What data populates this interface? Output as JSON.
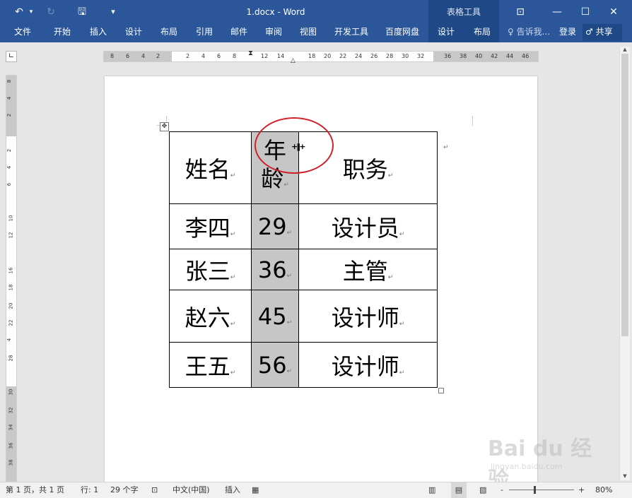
{
  "titlebar": {
    "title": "1.docx - Word",
    "context_group": "表格工具",
    "undo_icon": "↶",
    "redo_icon": "↻",
    "save_icon": "🖫",
    "customize_icon": "▾",
    "ribbon_display_icon": "⊡",
    "minimize_icon": "—",
    "maximize_icon": "☐",
    "close_icon": "✕"
  },
  "ribbon": {
    "tabs": [
      "文件",
      "开始",
      "插入",
      "设计",
      "布局",
      "引用",
      "邮件",
      "审阅",
      "视图",
      "开发工具",
      "百度网盘"
    ],
    "context_tabs": [
      "设计",
      "布局"
    ],
    "tell_me": "告诉我...",
    "signin": "登录",
    "share": "共享"
  },
  "ruler": {
    "h_left_ticks": [
      "8",
      "6",
      "4",
      "2"
    ],
    "h_ticks": [
      "2",
      "4",
      "6",
      "8",
      "12",
      "14",
      "18",
      "20",
      "22",
      "24",
      "26",
      "28",
      "30",
      "32",
      "36",
      "38",
      "40",
      "42",
      "44",
      "46"
    ],
    "v_ticks": [
      "8",
      "4",
      "2",
      "2",
      "4",
      "6",
      "10",
      "12",
      "16",
      "18",
      "20",
      "22",
      "4",
      "28",
      "30",
      "32",
      "34",
      "36",
      "38"
    ]
  },
  "table": {
    "rows": [
      {
        "name": "姓名",
        "age": "年龄",
        "title": "职务"
      },
      {
        "name": "李四",
        "age": "29",
        "title": "设计员"
      },
      {
        "name": "张三",
        "age": "36",
        "title": "主管"
      },
      {
        "name": "赵六",
        "age": "45",
        "title": "设计师"
      },
      {
        "name": "王五",
        "age": "56",
        "title": "设计师"
      }
    ],
    "paragraph_mark": "↵",
    "move_handle": "✥",
    "resize_cursor": "+||+"
  },
  "statusbar": {
    "page": "第 1 页，共 1 页",
    "line": "行: 1",
    "words": "29 个字",
    "language": "中文(中国)",
    "mode": "插入",
    "zoom": "80%",
    "zoom_minus": "-",
    "zoom_plus": "+"
  },
  "watermark": {
    "main": "Bai du 经验",
    "sub": "jingyan.baidu.com"
  },
  "colors": {
    "word_blue": "#2b579a",
    "context_blue": "#1f4986",
    "annotation_red": "#d0202a",
    "selection_grey": "#c6c6c6"
  }
}
